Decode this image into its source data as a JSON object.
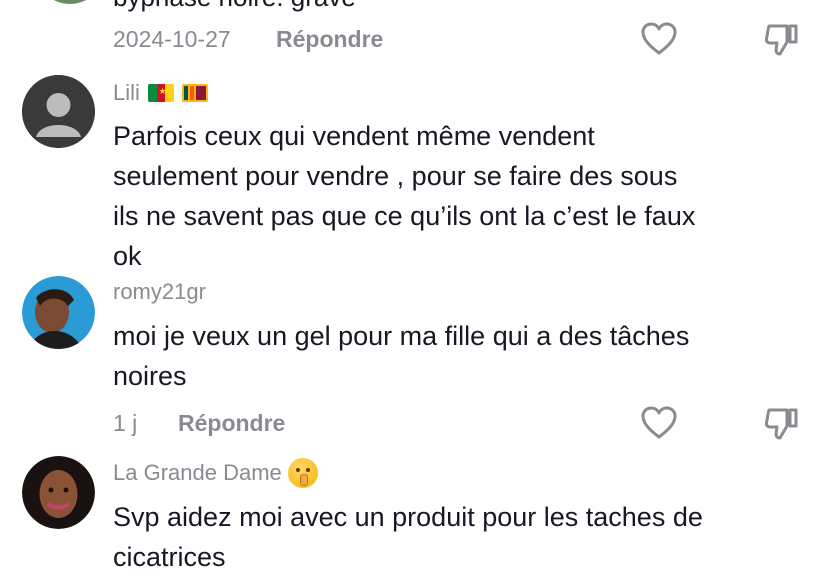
{
  "top_comment": {
    "partial_text": "byphase noire. grave",
    "date": "2024-10-27",
    "reply_label": "Répondre"
  },
  "comments": [
    {
      "username": "Lili",
      "lines": [
        "Parfois ceux qui vendent même vendent",
        "seulement pour vendre , pour se faire des sous",
        "ils ne savent pas que ce qu’ils ont la c’est le faux",
        "ok"
      ]
    },
    {
      "username": "romy21gr",
      "lines": [
        "moi je veux un gel pour ma fille qui a des tâches",
        "noires"
      ],
      "time": "1 j",
      "reply_label": "Répondre"
    },
    {
      "username": "La Grande Dame",
      "lines": [
        "Svp aidez moi avec un produit pour les taches de",
        "cicatrices"
      ]
    }
  ],
  "colors": {
    "text": "#161823",
    "meta": "#8a8b91",
    "icon": "#8a8b91"
  },
  "icons": [
    "heart-icon",
    "dislike-icon",
    "cameroon-flag-icon",
    "sri-lanka-flag-icon",
    "shushing-face-emoji"
  ]
}
